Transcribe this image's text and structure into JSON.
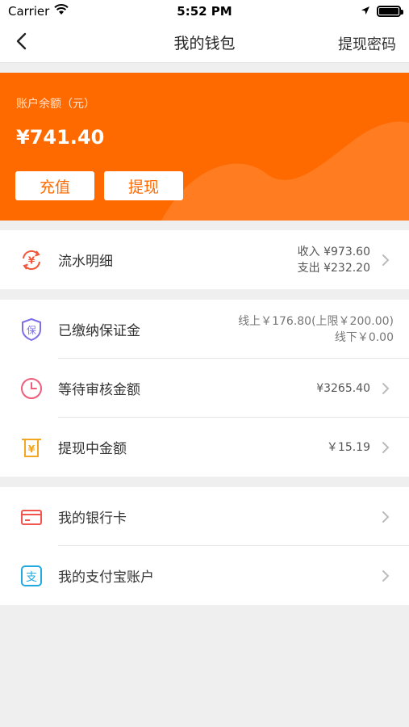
{
  "status_bar": {
    "carrier": "Carrier",
    "time": "5:52 PM"
  },
  "nav": {
    "title": "我的钱包",
    "right_action": "提现密码",
    "back_icon": "chevron-left-icon"
  },
  "balance": {
    "label": "账户余额（元）",
    "amount": "¥741.40",
    "recharge_label": "充值",
    "withdraw_label": "提现",
    "accent_color": "#ff6a00"
  },
  "flow": {
    "label": "流水明细",
    "income": "收入 ¥973.60",
    "expense": "支出 ¥232.20",
    "icon": "yen-exchange-icon",
    "icon_color": "#f0563a"
  },
  "deposit": {
    "label": "已缴纳保证金",
    "online": "线上￥176.80(上限￥200.00)",
    "offline": "线下￥0.00",
    "icon": "shield-bao-icon",
    "icon_color": "#7b6ee8"
  },
  "pending": {
    "label": "等待审核金额",
    "value": "¥3265.40",
    "icon": "clock-icon",
    "icon_color": "#ee5d7b"
  },
  "withdrawing": {
    "label": "提现中金额",
    "value": "￥15.19",
    "icon": "yen-receipt-icon",
    "icon_color": "#f3a623"
  },
  "bank_card": {
    "label": "我的银行卡",
    "icon": "bank-card-icon",
    "icon_color": "#f0564e"
  },
  "alipay": {
    "label": "我的支付宝账户",
    "icon": "alipay-icon",
    "icon_color": "#21a9e1"
  }
}
